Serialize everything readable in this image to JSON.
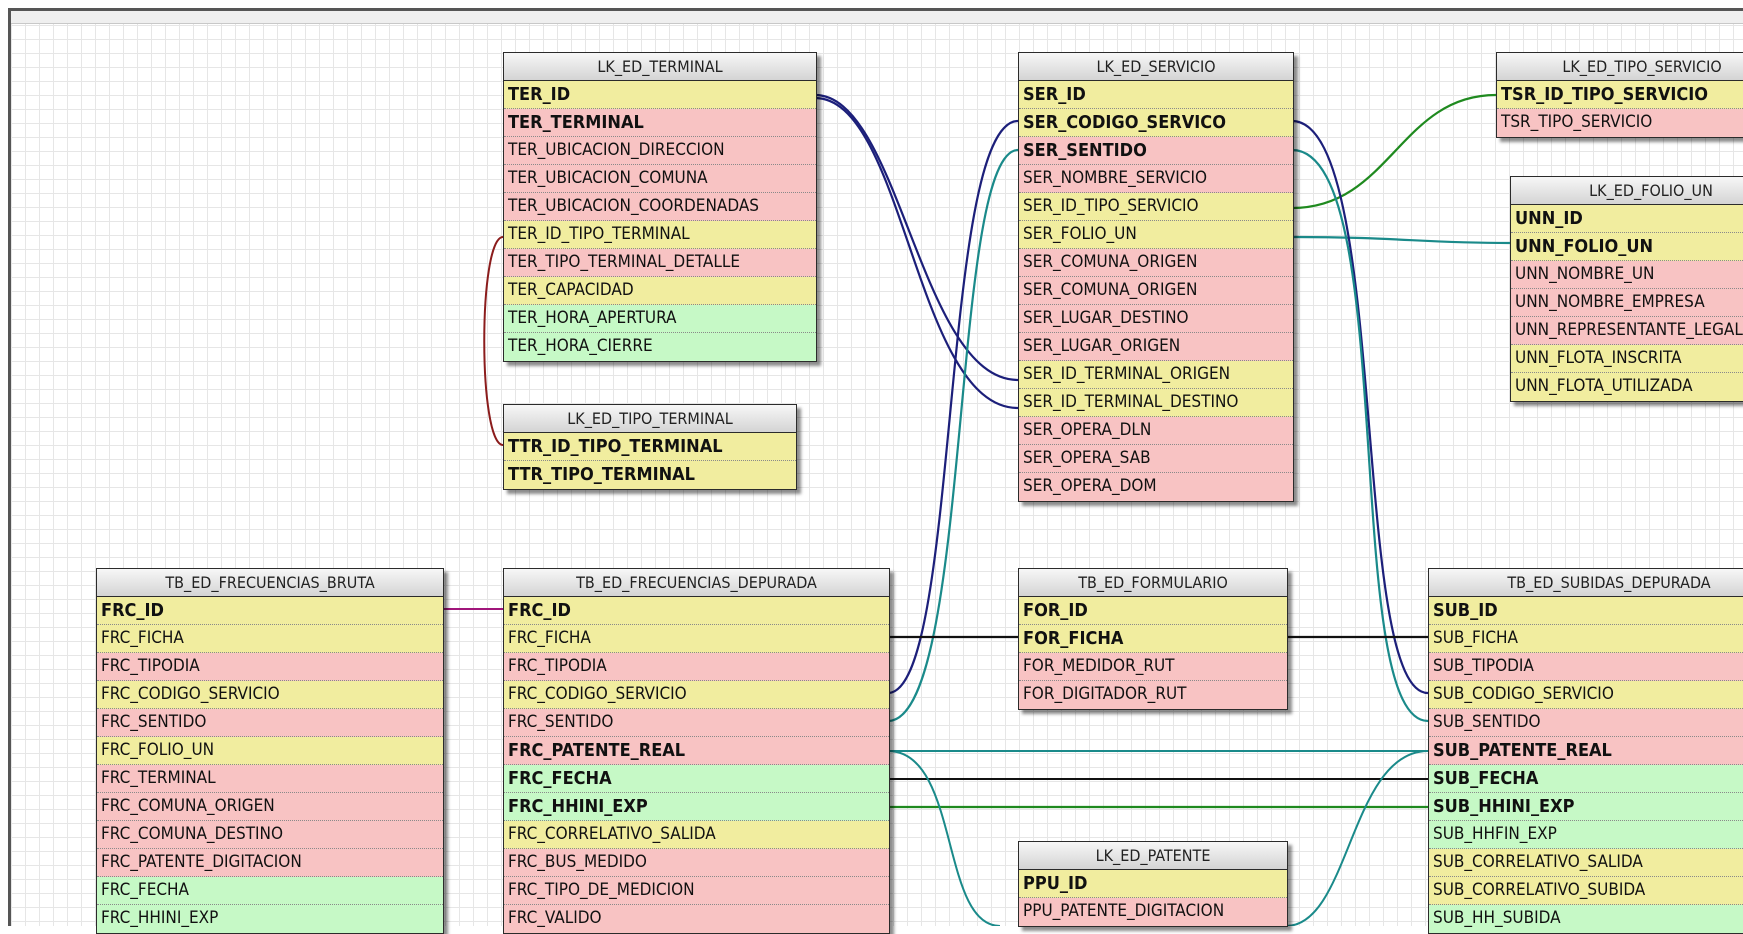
{
  "colors": {
    "yellow": "#f1ed9f",
    "pink": "#f8c3c3",
    "green": "#c6f9c6",
    "link_navy": "#1c1f7a",
    "link_teal": "#1a8a8a",
    "link_green": "#1f8a1f",
    "link_black": "#111111",
    "link_maroon": "#8b1c1c",
    "link_magenta": "#a0157a"
  },
  "tables": {
    "lk_ed_terminal": {
      "title": "LK_ED_TERMINAL",
      "rows": [
        {
          "name": "TER_ID",
          "color": "yellow",
          "bold": true
        },
        {
          "name": "TER_TERMINAL",
          "color": "pink",
          "bold": true
        },
        {
          "name": "TER_UBICACION_DIRECCION",
          "color": "pink",
          "bold": false
        },
        {
          "name": "TER_UBICACION_COMUNA",
          "color": "pink",
          "bold": false
        },
        {
          "name": "TER_UBICACION_COORDENADAS",
          "color": "pink",
          "bold": false
        },
        {
          "name": "TER_ID_TIPO_TERMINAL",
          "color": "yellow",
          "bold": false
        },
        {
          "name": "TER_TIPO_TERMINAL_DETALLE",
          "color": "pink",
          "bold": false
        },
        {
          "name": "TER_CAPACIDAD",
          "color": "yellow",
          "bold": false
        },
        {
          "name": "TER_HORA_APERTURA",
          "color": "green",
          "bold": false
        },
        {
          "name": "TER_HORA_CIERRE",
          "color": "green",
          "bold": false
        }
      ]
    },
    "lk_ed_tipo_terminal": {
      "title": "LK_ED_TIPO_TERMINAL",
      "rows": [
        {
          "name": "TTR_ID_TIPO_TERMINAL",
          "color": "yellow",
          "bold": true
        },
        {
          "name": "TTR_TIPO_TERMINAL",
          "color": "yellow",
          "bold": true
        }
      ]
    },
    "lk_ed_servicio": {
      "title": "LK_ED_SERVICIO",
      "rows": [
        {
          "name": "SER_ID",
          "color": "yellow",
          "bold": true
        },
        {
          "name": "SER_CODIGO_SERVICO",
          "color": "yellow",
          "bold": true
        },
        {
          "name": "SER_SENTIDO",
          "color": "pink",
          "bold": true
        },
        {
          "name": "SER_NOMBRE_SERVICIO",
          "color": "pink",
          "bold": false
        },
        {
          "name": "SER_ID_TIPO_SERVICIO",
          "color": "yellow",
          "bold": false
        },
        {
          "name": "SER_FOLIO_UN",
          "color": "yellow",
          "bold": false
        },
        {
          "name": "SER_COMUNA_ORIGEN",
          "color": "pink",
          "bold": false
        },
        {
          "name": "SER_COMUNA_ORIGEN",
          "color": "pink",
          "bold": false
        },
        {
          "name": "SER_LUGAR_DESTINO",
          "color": "pink",
          "bold": false
        },
        {
          "name": "SER_LUGAR_ORIGEN",
          "color": "pink",
          "bold": false
        },
        {
          "name": "SER_ID_TERMINAL_ORIGEN",
          "color": "yellow",
          "bold": false
        },
        {
          "name": "SER_ID_TERMINAL_DESTINO",
          "color": "yellow",
          "bold": false
        },
        {
          "name": "SER_OPERA_DLN",
          "color": "pink",
          "bold": false
        },
        {
          "name": "SER_OPERA_SAB",
          "color": "pink",
          "bold": false
        },
        {
          "name": "SER_OPERA_DOM",
          "color": "pink",
          "bold": false
        }
      ]
    },
    "lk_ed_tipo_servicio": {
      "title": "LK_ED_TIPO_SERVICIO",
      "rows": [
        {
          "name": "TSR_ID_TIPO_SERVICIO",
          "color": "yellow",
          "bold": true
        },
        {
          "name": "TSR_TIPO_SERVICIO",
          "color": "pink",
          "bold": false
        }
      ]
    },
    "lk_ed_folio_un": {
      "title": "LK_ED_FOLIO_UN",
      "rows": [
        {
          "name": "UNN_ID",
          "color": "yellow",
          "bold": true
        },
        {
          "name": "UNN_FOLIO_UN",
          "color": "yellow",
          "bold": true
        },
        {
          "name": "UNN_NOMBRE_UN",
          "color": "pink",
          "bold": false
        },
        {
          "name": "UNN_NOMBRE_EMPRESA",
          "color": "pink",
          "bold": false
        },
        {
          "name": "UNN_REPRESENTANTE_LEGAL",
          "color": "pink",
          "bold": false
        },
        {
          "name": "UNN_FLOTA_INSCRITA",
          "color": "yellow",
          "bold": false
        },
        {
          "name": "UNN_FLOTA_UTILIZADA",
          "color": "yellow",
          "bold": false
        }
      ]
    },
    "tb_ed_frecuencias_bruta": {
      "title": "TB_ED_FRECUENCIAS_BRUTA",
      "rows": [
        {
          "name": "FRC_ID",
          "color": "yellow",
          "bold": true
        },
        {
          "name": "FRC_FICHA",
          "color": "yellow",
          "bold": false
        },
        {
          "name": "FRC_TIPODIA",
          "color": "pink",
          "bold": false
        },
        {
          "name": "FRC_CODIGO_SERVICIO",
          "color": "yellow",
          "bold": false
        },
        {
          "name": "FRC_SENTIDO",
          "color": "pink",
          "bold": false
        },
        {
          "name": "FRC_FOLIO_UN",
          "color": "yellow",
          "bold": false
        },
        {
          "name": "FRC_TERMINAL",
          "color": "pink",
          "bold": false
        },
        {
          "name": "FRC_COMUNA_ORIGEN",
          "color": "pink",
          "bold": false
        },
        {
          "name": "FRC_COMUNA_DESTINO",
          "color": "pink",
          "bold": false
        },
        {
          "name": "FRC_PATENTE_DIGITACION",
          "color": "pink",
          "bold": false
        },
        {
          "name": "FRC_FECHA",
          "color": "green",
          "bold": false
        },
        {
          "name": "FRC_HHINI_EXP",
          "color": "green",
          "bold": false
        }
      ]
    },
    "tb_ed_frecuencias_depurada": {
      "title": "TB_ED_FRECUENCIAS_DEPURADA",
      "rows": [
        {
          "name": "FRC_ID",
          "color": "yellow",
          "bold": true
        },
        {
          "name": "FRC_FICHA",
          "color": "yellow",
          "bold": false
        },
        {
          "name": "FRC_TIPODIA",
          "color": "pink",
          "bold": false
        },
        {
          "name": "FRC_CODIGO_SERVICIO",
          "color": "yellow",
          "bold": false
        },
        {
          "name": "FRC_SENTIDO",
          "color": "pink",
          "bold": false
        },
        {
          "name": "FRC_PATENTE_REAL",
          "color": "pink",
          "bold": true
        },
        {
          "name": "FRC_FECHA",
          "color": "green",
          "bold": true
        },
        {
          "name": "FRC_HHINI_EXP",
          "color": "green",
          "bold": true
        },
        {
          "name": "FRC_CORRELATIVO_SALIDA",
          "color": "yellow",
          "bold": false
        },
        {
          "name": "FRC_BUS_MEDIDO",
          "color": "pink",
          "bold": false
        },
        {
          "name": "FRC_TIPO_DE_MEDICION",
          "color": "pink",
          "bold": false
        },
        {
          "name": "FRC_VALIDO",
          "color": "pink",
          "bold": false
        }
      ]
    },
    "tb_ed_formulario": {
      "title": "TB_ED_FORMULARIO",
      "rows": [
        {
          "name": "FOR_ID",
          "color": "yellow",
          "bold": true
        },
        {
          "name": "FOR_FICHA",
          "color": "yellow",
          "bold": true
        },
        {
          "name": "FOR_MEDIDOR_RUT",
          "color": "pink",
          "bold": false
        },
        {
          "name": "FOR_DIGITADOR_RUT",
          "color": "pink",
          "bold": false
        }
      ]
    },
    "lk_ed_patente": {
      "title": "LK_ED_PATENTE",
      "rows": [
        {
          "name": "PPU_ID",
          "color": "yellow",
          "bold": true
        },
        {
          "name": "PPU_PATENTE_DIGITACION",
          "color": "pink",
          "bold": false
        }
      ]
    },
    "tb_ed_subidas_depurada": {
      "title": "TB_ED_SUBIDAS_DEPURADA",
      "rows": [
        {
          "name": "SUB_ID",
          "color": "yellow",
          "bold": true
        },
        {
          "name": "SUB_FICHA",
          "color": "yellow",
          "bold": false
        },
        {
          "name": "SUB_TIPODIA",
          "color": "pink",
          "bold": false
        },
        {
          "name": "SUB_CODIGO_SERVICIO",
          "color": "yellow",
          "bold": false
        },
        {
          "name": "SUB_SENTIDO",
          "color": "pink",
          "bold": false
        },
        {
          "name": "SUB_PATENTE_REAL",
          "color": "pink",
          "bold": true
        },
        {
          "name": "SUB_FECHA",
          "color": "green",
          "bold": true
        },
        {
          "name": "SUB_HHINI_EXP",
          "color": "green",
          "bold": true
        },
        {
          "name": "SUB_HHFIN_EXP",
          "color": "green",
          "bold": false
        },
        {
          "name": "SUB_CORRELATIVO_SALIDA",
          "color": "yellow",
          "bold": false
        },
        {
          "name": "SUB_CORRELATIVO_SUBIDA",
          "color": "yellow",
          "bold": false
        },
        {
          "name": "SUB_HH_SUBIDA",
          "color": "green",
          "bold": false
        }
      ]
    }
  }
}
